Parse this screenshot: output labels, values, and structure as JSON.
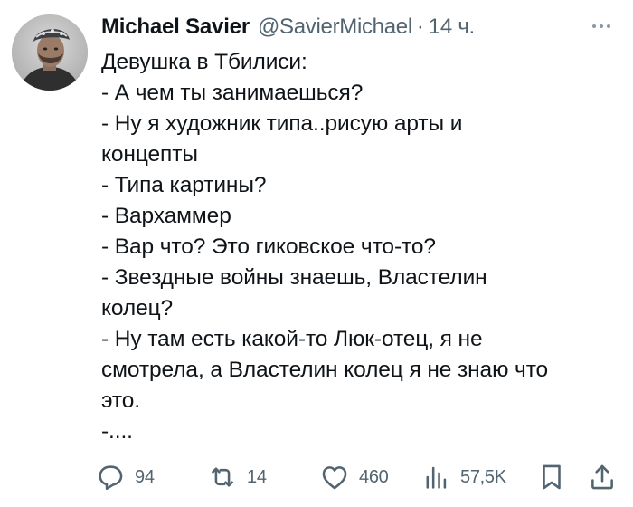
{
  "author": {
    "name": "Michael Savier",
    "handle": "@SavierMichael",
    "separator": "·",
    "time": "14 ч."
  },
  "tweet": {
    "lines": [
      "Девушка в Тбилиси:",
      "- А чем ты занимаешься?",
      "- Ну я художник типа..рисую арты и",
      "концепты",
      "- Типа картины?",
      "- Вархаммер",
      "- Вар что? Это гиковское что-то?",
      "- Звездные войны знаешь, Властелин",
      "колец?",
      "- Ну там есть какой-то Люк-отец, я не",
      "смотрела, а Властелин колец я не знаю что",
      "это.",
      "-...."
    ]
  },
  "actions": {
    "replies": "94",
    "retweets": "14",
    "likes": "460",
    "views": "57,5K"
  },
  "icons": {
    "more": "more-dots-icon",
    "reply": "reply-bubble-icon",
    "retweet": "retweet-icon",
    "like": "heart-icon",
    "views": "analytics-bars-icon",
    "bookmark": "bookmark-icon",
    "share": "share-upload-icon"
  },
  "colors": {
    "text": "#0f1419",
    "secondary": "#536471"
  }
}
